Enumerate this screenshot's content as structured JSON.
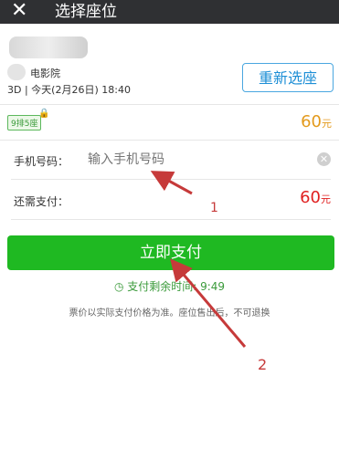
{
  "header": {
    "close_icon": "close-icon",
    "title": "选择座位"
  },
  "movie": {
    "cinema_suffix": "电影院",
    "showtime": "3D | 今天(2月26日) 18:40",
    "reselect_label": "重新选座"
  },
  "seat": {
    "tag": "9排5座",
    "price": "60",
    "unit": "元"
  },
  "form": {
    "phone_label": "手机号码：",
    "phone_placeholder": "输入手机号码",
    "due_label": "还需支付：",
    "due_price": "60",
    "due_unit": "元"
  },
  "pay": {
    "button_label": "立即支付",
    "countdown": "支付剩余时间: 9:49"
  },
  "notice": "票价以实际支付价格为准。座位售出后，不可退换",
  "annotations": {
    "one": "1",
    "two": "2"
  },
  "colors": {
    "topbar": "#2f3033",
    "accent_blue": "#1e8fd6",
    "pay_green": "#1fb922",
    "price_red": "#e02020",
    "price_orange": "#e39a1c",
    "annotation_red": "#c63a3a"
  }
}
